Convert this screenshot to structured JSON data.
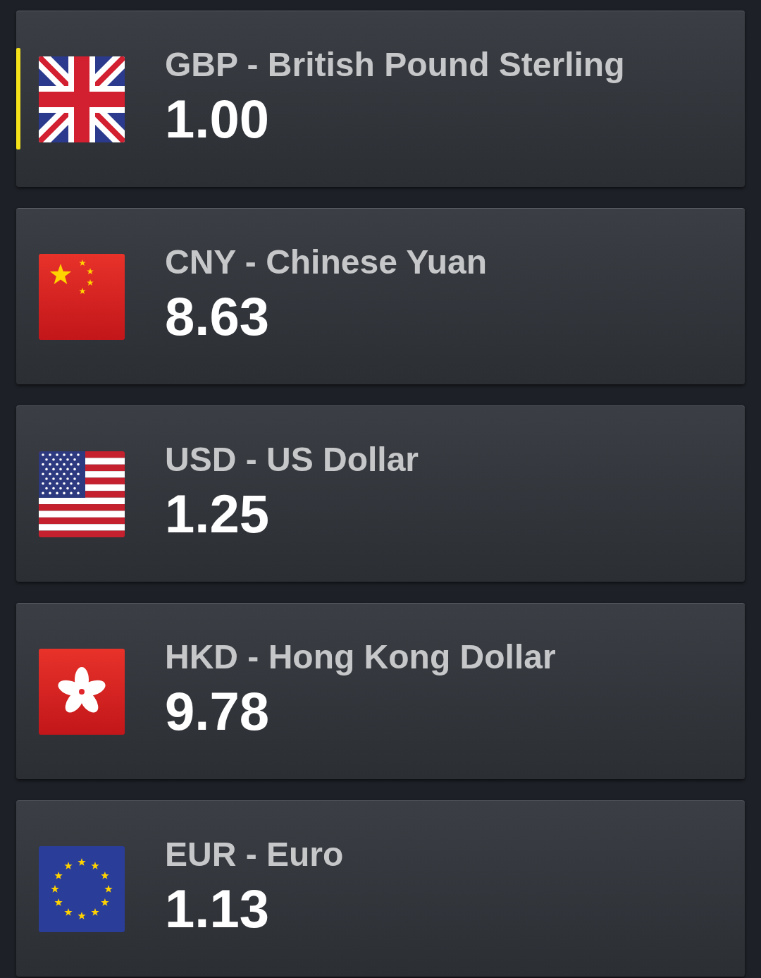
{
  "currencies": [
    {
      "kind": "gb",
      "name": "GBP - British Pound Sterling",
      "amount": "1.00",
      "selected": true
    },
    {
      "kind": "cn",
      "name": "CNY - Chinese Yuan",
      "amount": "8.63",
      "selected": false
    },
    {
      "kind": "us",
      "name": "USD - US Dollar",
      "amount": "1.25",
      "selected": false
    },
    {
      "kind": "hk",
      "name": "HKD - Hong Kong Dollar",
      "amount": "9.78",
      "selected": false
    },
    {
      "kind": "eu",
      "name": "EUR - Euro",
      "amount": "1.13",
      "selected": false
    }
  ]
}
